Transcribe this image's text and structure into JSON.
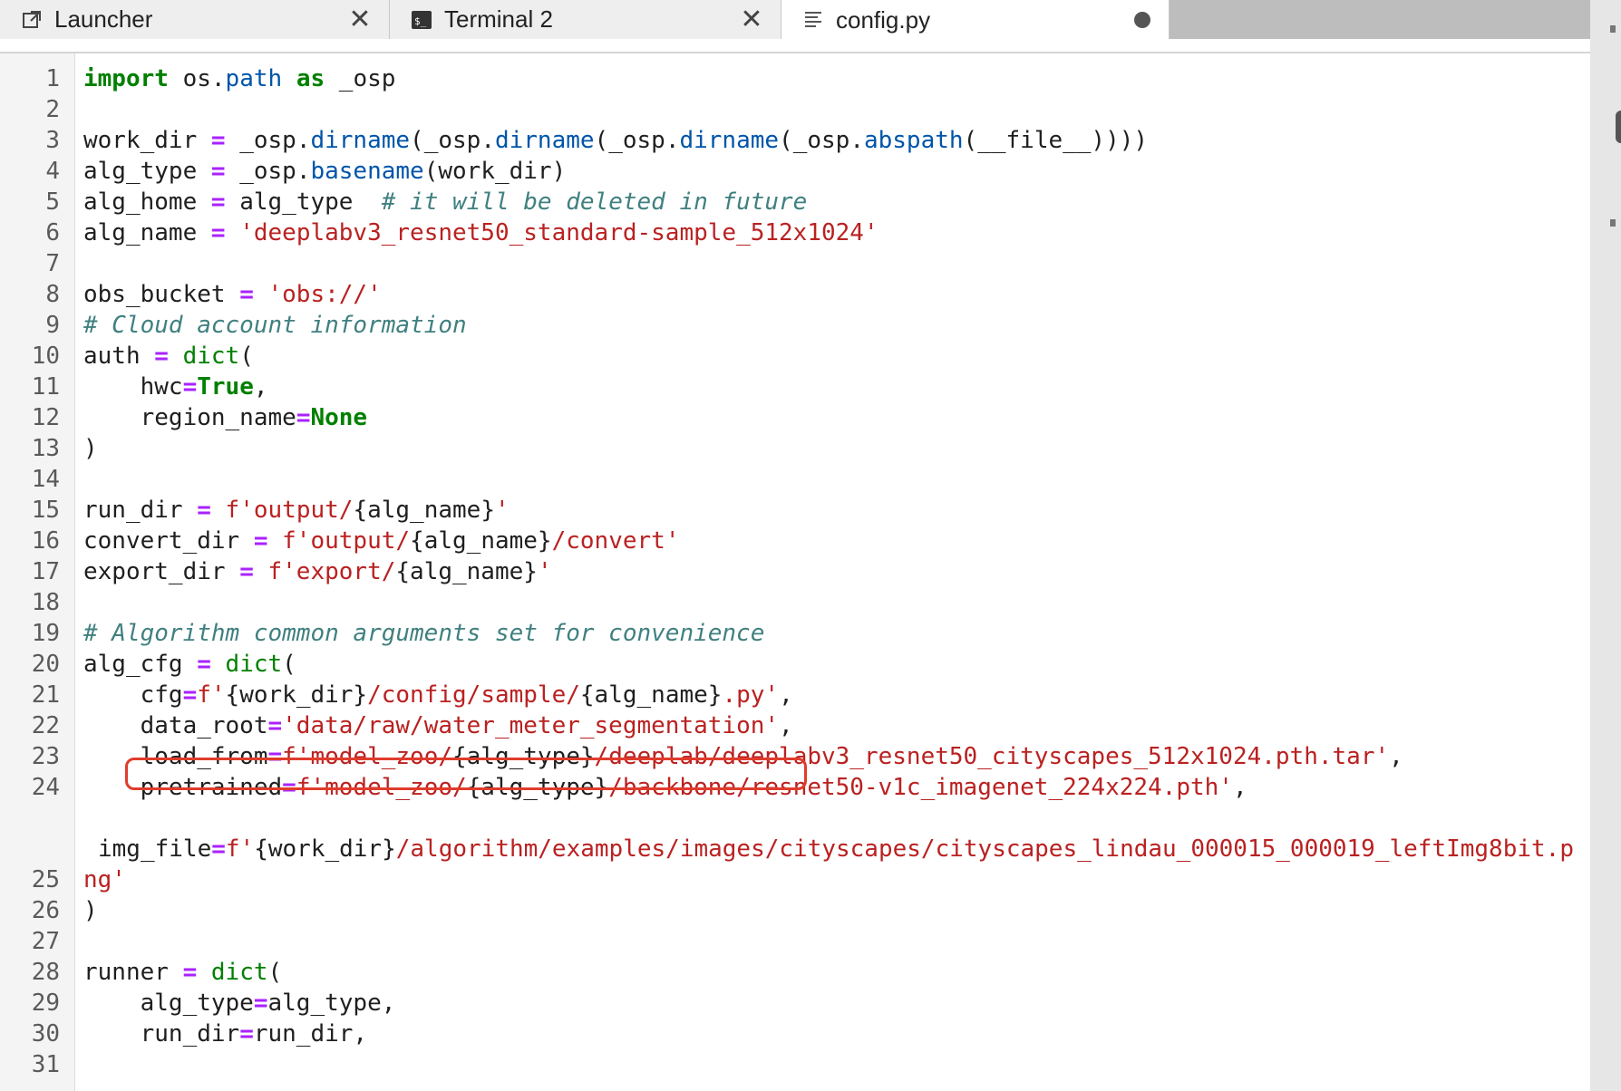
{
  "tabs": [
    {
      "label": "Launcher",
      "icon": "launcher-icon",
      "close": "✕"
    },
    {
      "label": "Terminal 2",
      "icon": "terminal-icon",
      "close": "✕"
    },
    {
      "label": "config.py",
      "icon": "file-text-icon",
      "active": true,
      "modified": true
    }
  ],
  "editor": {
    "highlight_color": "#e03c2c",
    "lines": [
      {
        "n": "1",
        "tokens": [
          {
            "t": "import",
            "c": "kw"
          },
          {
            "t": " os.",
            "c": "plain"
          },
          {
            "t": "path",
            "c": "fn"
          },
          {
            "t": " ",
            "c": "plain"
          },
          {
            "t": "as",
            "c": "kw"
          },
          {
            "t": " _osp",
            "c": "plain"
          }
        ]
      },
      {
        "n": "2",
        "tokens": []
      },
      {
        "n": "3",
        "tokens": [
          {
            "t": "work_dir ",
            "c": "plain"
          },
          {
            "t": "=",
            "c": "op"
          },
          {
            "t": " _osp.",
            "c": "plain"
          },
          {
            "t": "dirname",
            "c": "fn"
          },
          {
            "t": "(_osp.",
            "c": "plain"
          },
          {
            "t": "dirname",
            "c": "fn"
          },
          {
            "t": "(_osp.",
            "c": "plain"
          },
          {
            "t": "dirname",
            "c": "fn"
          },
          {
            "t": "(_osp.",
            "c": "plain"
          },
          {
            "t": "abspath",
            "c": "fn"
          },
          {
            "t": "(__file__))))",
            "c": "plain"
          }
        ]
      },
      {
        "n": "4",
        "tokens": [
          {
            "t": "alg_type ",
            "c": "plain"
          },
          {
            "t": "=",
            "c": "op"
          },
          {
            "t": " _osp.",
            "c": "plain"
          },
          {
            "t": "basename",
            "c": "fn"
          },
          {
            "t": "(work_dir)",
            "c": "plain"
          }
        ]
      },
      {
        "n": "5",
        "tokens": [
          {
            "t": "alg_home ",
            "c": "plain"
          },
          {
            "t": "=",
            "c": "op"
          },
          {
            "t": " alg_type  ",
            "c": "plain"
          },
          {
            "t": "# it will be deleted in future",
            "c": "cm"
          }
        ]
      },
      {
        "n": "6",
        "tokens": [
          {
            "t": "alg_name ",
            "c": "plain"
          },
          {
            "t": "=",
            "c": "op"
          },
          {
            "t": " ",
            "c": "plain"
          },
          {
            "t": "'deeplabv3_resnet50_standard-sample_512x1024'",
            "c": "str"
          }
        ]
      },
      {
        "n": "7",
        "tokens": []
      },
      {
        "n": "8",
        "tokens": [
          {
            "t": "obs_bucket ",
            "c": "plain"
          },
          {
            "t": "=",
            "c": "op"
          },
          {
            "t": " ",
            "c": "plain"
          },
          {
            "t": "'obs://'",
            "c": "str"
          }
        ]
      },
      {
        "n": "9",
        "tokens": [
          {
            "t": "# Cloud account information",
            "c": "cm"
          }
        ]
      },
      {
        "n": "10",
        "tokens": [
          {
            "t": "auth ",
            "c": "plain"
          },
          {
            "t": "=",
            "c": "op"
          },
          {
            "t": " ",
            "c": "plain"
          },
          {
            "t": "dict",
            "c": "bi"
          },
          {
            "t": "(",
            "c": "plain"
          }
        ]
      },
      {
        "n": "11",
        "tokens": [
          {
            "t": "    hwc",
            "c": "plain"
          },
          {
            "t": "=",
            "c": "op"
          },
          {
            "t": "True",
            "c": "kw"
          },
          {
            "t": ",",
            "c": "plain"
          }
        ]
      },
      {
        "n": "12",
        "tokens": [
          {
            "t": "    region_name",
            "c": "plain"
          },
          {
            "t": "=",
            "c": "op"
          },
          {
            "t": "None",
            "c": "kw"
          }
        ]
      },
      {
        "n": "13",
        "tokens": [
          {
            "t": ")",
            "c": "plain"
          }
        ]
      },
      {
        "n": "14",
        "tokens": []
      },
      {
        "n": "15",
        "tokens": [
          {
            "t": "run_dir ",
            "c": "plain"
          },
          {
            "t": "=",
            "c": "op"
          },
          {
            "t": " ",
            "c": "plain"
          },
          {
            "t": "f'output/",
            "c": "str"
          },
          {
            "t": "{alg_name}",
            "c": "plain"
          },
          {
            "t": "'",
            "c": "str"
          }
        ]
      },
      {
        "n": "16",
        "tokens": [
          {
            "t": "convert_dir ",
            "c": "plain"
          },
          {
            "t": "=",
            "c": "op"
          },
          {
            "t": " ",
            "c": "plain"
          },
          {
            "t": "f'output/",
            "c": "str"
          },
          {
            "t": "{alg_name}",
            "c": "plain"
          },
          {
            "t": "/convert'",
            "c": "str"
          }
        ]
      },
      {
        "n": "17",
        "tokens": [
          {
            "t": "export_dir ",
            "c": "plain"
          },
          {
            "t": "=",
            "c": "op"
          },
          {
            "t": " ",
            "c": "plain"
          },
          {
            "t": "f'export/",
            "c": "str"
          },
          {
            "t": "{alg_name}",
            "c": "plain"
          },
          {
            "t": "'",
            "c": "str"
          }
        ]
      },
      {
        "n": "18",
        "tokens": []
      },
      {
        "n": "19",
        "tokens": [
          {
            "t": "# Algorithm common arguments set for convenience",
            "c": "cm"
          }
        ]
      },
      {
        "n": "20",
        "tokens": [
          {
            "t": "alg_cfg ",
            "c": "plain"
          },
          {
            "t": "=",
            "c": "op"
          },
          {
            "t": " ",
            "c": "plain"
          },
          {
            "t": "dict",
            "c": "bi"
          },
          {
            "t": "(",
            "c": "plain"
          }
        ]
      },
      {
        "n": "21",
        "tokens": [
          {
            "t": "    cfg",
            "c": "plain"
          },
          {
            "t": "=",
            "c": "op"
          },
          {
            "t": "f'",
            "c": "str"
          },
          {
            "t": "{work_dir}",
            "c": "plain"
          },
          {
            "t": "/config/sample/",
            "c": "str"
          },
          {
            "t": "{alg_name}",
            "c": "plain"
          },
          {
            "t": ".py'",
            "c": "str"
          },
          {
            "t": ",",
            "c": "plain"
          }
        ]
      },
      {
        "n": "22",
        "tokens": [
          {
            "t": "    data_root",
            "c": "plain"
          },
          {
            "t": "=",
            "c": "op"
          },
          {
            "t": "'data/raw/water_meter_segmentation'",
            "c": "str"
          },
          {
            "t": ",",
            "c": "plain"
          }
        ]
      },
      {
        "n": "23",
        "tokens": [
          {
            "t": "    load_from",
            "c": "plain"
          },
          {
            "t": "=",
            "c": "op"
          },
          {
            "t": "f'model_zoo/",
            "c": "str"
          },
          {
            "t": "{alg_type}",
            "c": "plain"
          },
          {
            "t": "/deeplab/deeplabv3_resnet50_cityscapes_512x1024.pth.tar'",
            "c": "str"
          },
          {
            "t": ",",
            "c": "plain"
          }
        ]
      },
      {
        "n": "24",
        "tokens": [
          {
            "t": "    pretrained",
            "c": "plain"
          },
          {
            "t": "=",
            "c": "op"
          },
          {
            "t": "f'model_zoo/",
            "c": "str"
          },
          {
            "t": "{alg_type}",
            "c": "plain"
          },
          {
            "t": "/backbone/resnet50-v1c_imagenet_224x224.pth'",
            "c": "str"
          },
          {
            "t": ",",
            "c": "plain"
          }
        ]
      },
      {
        "n": "25",
        "wrap": true,
        "tokens": [
          {
            "t": "img_file",
            "c": "plain"
          },
          {
            "t": "=",
            "c": "op"
          },
          {
            "t": "f'",
            "c": "str"
          },
          {
            "t": "{work_dir}",
            "c": "plain"
          },
          {
            "t": "/algorithm/examples/images/cityscapes/cityscapes_lindau_000015_000019_leftImg8bit.p",
            "c": "str"
          }
        ],
        "tokens2": [
          {
            "t": "ng'",
            "c": "str"
          }
        ]
      },
      {
        "n": "26",
        "tokens": [
          {
            "t": ")",
            "c": "plain"
          }
        ]
      },
      {
        "n": "27",
        "tokens": []
      },
      {
        "n": "28",
        "tokens": [
          {
            "t": "runner ",
            "c": "plain"
          },
          {
            "t": "=",
            "c": "op"
          },
          {
            "t": " ",
            "c": "plain"
          },
          {
            "t": "dict",
            "c": "bi"
          },
          {
            "t": "(",
            "c": "plain"
          }
        ]
      },
      {
        "n": "29",
        "tokens": [
          {
            "t": "    alg_type",
            "c": "plain"
          },
          {
            "t": "=",
            "c": "op"
          },
          {
            "t": "alg_type,",
            "c": "plain"
          }
        ]
      },
      {
        "n": "30",
        "tokens": [
          {
            "t": "    run_dir",
            "c": "plain"
          },
          {
            "t": "=",
            "c": "op"
          },
          {
            "t": "run_dir,",
            "c": "plain"
          }
        ]
      },
      {
        "n": "31",
        "tokens": []
      }
    ]
  }
}
